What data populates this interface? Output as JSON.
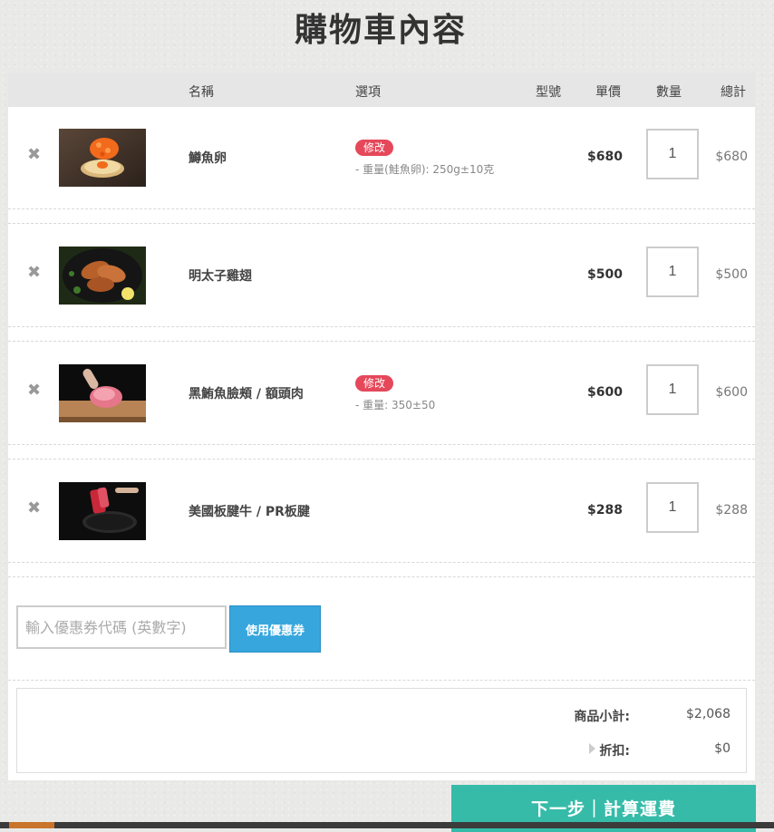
{
  "page": {
    "title": "購物車內容"
  },
  "table": {
    "headers": {
      "name": "名稱",
      "options": "選項",
      "model": "型號",
      "unit_price": "單價",
      "quantity": "數量",
      "total": "總計"
    }
  },
  "items": [
    {
      "name": "鱒魚卵",
      "badge": "修改",
      "option": "- 重量(鮭魚卵): 250g±10克",
      "unit_price": "$680",
      "quantity": "1",
      "total": "$680",
      "image_icon": "salmon-roe-image"
    },
    {
      "name": "明太子雞翅",
      "badge": "",
      "option": "",
      "unit_price": "$500",
      "quantity": "1",
      "total": "$500",
      "image_icon": "chicken-wings-image"
    },
    {
      "name": "黑鮪魚臉頰 / 額頭肉",
      "badge": "修改",
      "option": "- 重量: 350±50",
      "unit_price": "$600",
      "quantity": "1",
      "total": "$600",
      "image_icon": "tuna-cheek-image"
    },
    {
      "name": "美國板腱牛 / PR板腱",
      "badge": "",
      "option": "",
      "unit_price": "$288",
      "quantity": "1",
      "total": "$288",
      "image_icon": "beef-steak-image"
    }
  ],
  "coupon": {
    "placeholder": "輸入優惠券代碼 (英數字)",
    "button_label": "使用優惠券"
  },
  "summary": {
    "subtotal_label": "商品小計:",
    "subtotal_value": "$2,068",
    "discount_label": "折扣:",
    "discount_value": "$0"
  },
  "next_button": {
    "label": "下一步｜計算運費"
  },
  "colors": {
    "badge": "#e5485a",
    "coupon_button": "#36a6dd",
    "next_button": "#36bba9"
  }
}
